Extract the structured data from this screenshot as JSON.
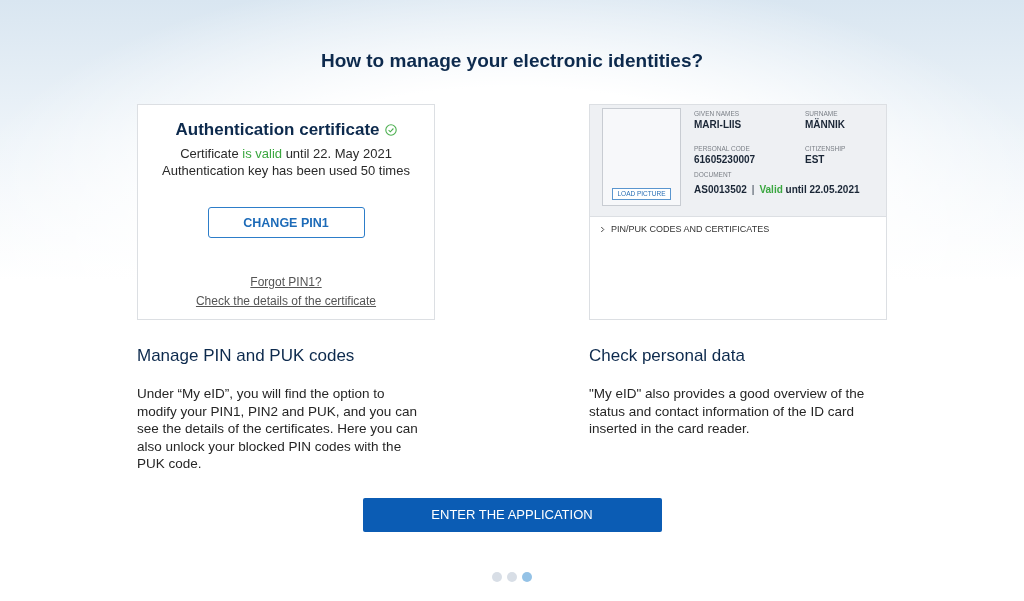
{
  "page": {
    "title": "How to manage your electronic identities?"
  },
  "features": [
    {
      "kind": "certificate",
      "preview": {
        "title": "Authentication certificate",
        "validity": {
          "before": "Certificate",
          "status": "is valid",
          "after": "until 22. May 2021",
          "valid": true
        },
        "usage": "Authentication key has been used 50 times",
        "button": "CHANGE PIN1",
        "links": [
          "Forgot PIN1?",
          "Check the details of the certificate"
        ]
      },
      "heading": "Manage PIN and PUK codes",
      "text": "Under “My eID”, you will find the option to modify your PIN1, PIN2 and PUK, and you can see the details of the certificates. Here you can also unlock your blocked PIN codes with the PUK code."
    },
    {
      "kind": "personal",
      "preview": {
        "photo_button": "LOAD PICTURE",
        "fields": [
          {
            "label": "GIVEN NAMES",
            "value": "MARI-LIIS"
          },
          {
            "label": "SURNAME",
            "value": "MÄNNIK"
          },
          {
            "label": "PERSONAL CODE",
            "value": "61605230007"
          },
          {
            "label": "CITIZENSHIP",
            "value": "EST"
          }
        ],
        "document": {
          "label": "DOCUMENT",
          "number": "AS0013502",
          "separator": "|",
          "status": "Valid",
          "until": "until 22.05.2021",
          "valid": true
        },
        "expander": {
          "label": "PIN/PUK CODES AND CERTIFICATES",
          "expanded": false
        }
      },
      "heading": "Check personal data",
      "text": "\"My eID\" also provides a good overview of the status and contact information of the ID card inserted in the card reader."
    }
  ],
  "action": {
    "label": "ENTER THE APPLICATION"
  },
  "pager": [
    {
      "selected": false
    },
    {
      "selected": false
    },
    {
      "selected": true
    }
  ]
}
